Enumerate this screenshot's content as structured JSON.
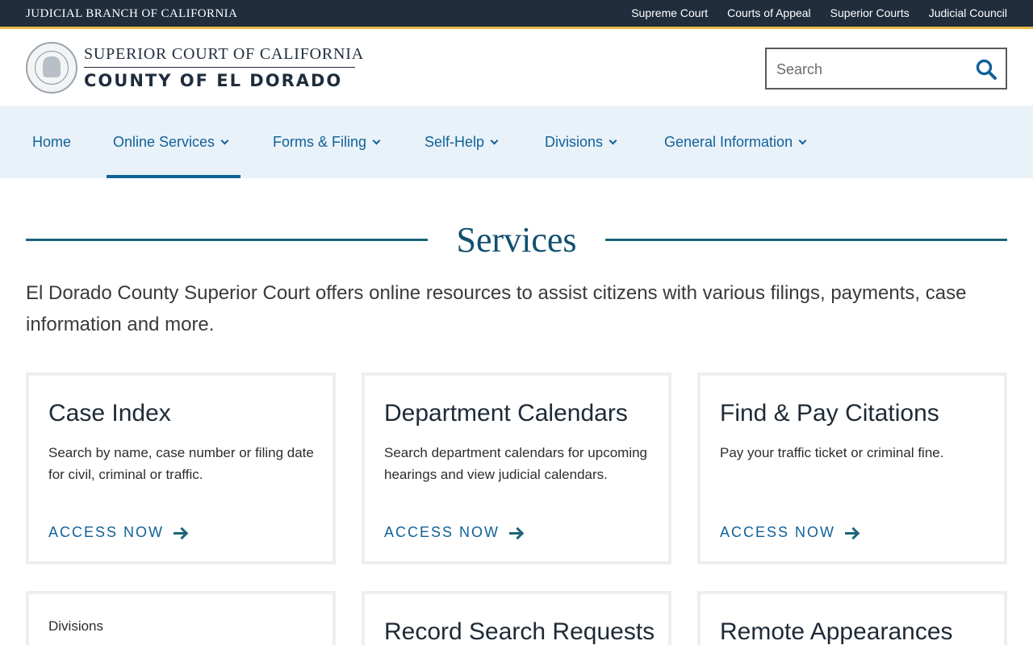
{
  "topbar": {
    "branch": "JUDICIAL BRANCH OF CALIFORNIA",
    "links": [
      "Supreme Court",
      "Courts of Appeal",
      "Superior Courts",
      "Judicial Council"
    ]
  },
  "header": {
    "line1": "SUPERIOR COURT OF CALIFORNIA",
    "line2": "COUNTY OF EL DORADO",
    "search_placeholder": "Search"
  },
  "nav": {
    "items": [
      {
        "label": "Home"
      },
      {
        "label": "Online Services"
      },
      {
        "label": "Forms & Filing"
      },
      {
        "label": "Self-Help"
      },
      {
        "label": "Divisions"
      },
      {
        "label": "General Information"
      }
    ],
    "active": "Online Services"
  },
  "main": {
    "heading": "Services",
    "intro": "El Dorado County Superior Court offers online resources to assist citizens with various filings, payments, case information and more.",
    "cards": [
      {
        "title": "Case Index",
        "desc": "Search by name, case number or filing date for civil, criminal or traffic.",
        "link": "ACCESS NOW"
      },
      {
        "title": "Department Calendars",
        "desc": "Search department calendars for upcoming hearings and view judicial calendars.",
        "link": "ACCESS NOW"
      },
      {
        "title": "Find & Pay Citations",
        "desc": "Pay your traffic ticket or criminal fine.",
        "link": "ACCESS NOW"
      },
      {
        "title": "Divisions"
      },
      {
        "title": "Record Search Requests"
      },
      {
        "title": "Remote Appearances"
      }
    ]
  },
  "colors": {
    "topbar": "#1f2d3d",
    "accent_gold": "#e9b949",
    "link_blue": "#10619a",
    "nav_bg": "#eaf2f9",
    "rule_teal": "#1b6477"
  }
}
